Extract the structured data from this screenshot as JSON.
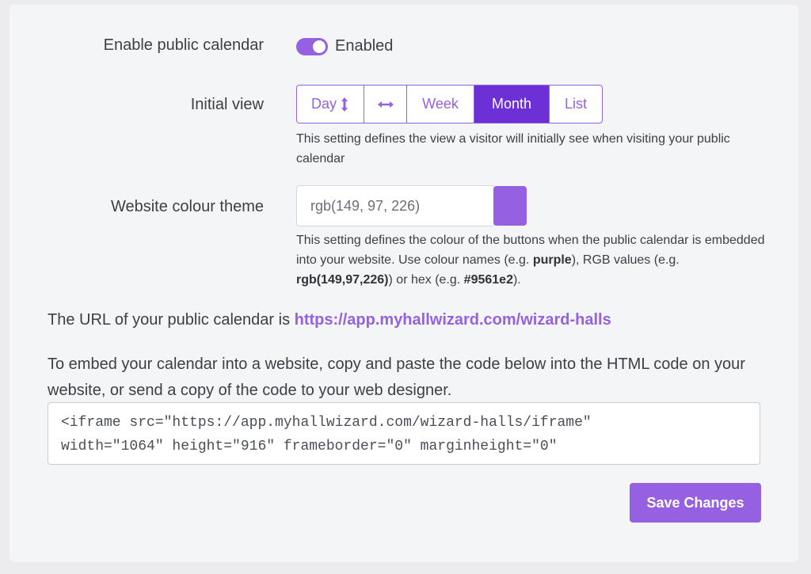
{
  "settings": {
    "public_calendar": {
      "label": "Enable public calendar",
      "status": "Enabled",
      "enabled": true
    },
    "initial_view": {
      "label": "Initial view",
      "options": [
        "Day",
        "",
        "Week",
        "Month",
        "List"
      ],
      "selected": "Month",
      "help": "This setting defines the view a visitor will initially see when visiting your public calendar"
    },
    "colour_theme": {
      "label": "Website colour theme",
      "value": "rgb(149, 97, 226)",
      "swatch_color": "#9561e2",
      "help_before": "This setting defines the colour of the buttons when the public calendar is embedded into your website. Use colour names (e.g. ",
      "help_purple": "purple",
      "help_mid1": "), RGB values (e.g. ",
      "help_rgb": "rgb(149,97,226)",
      "help_mid2": ") or hex (e.g. ",
      "help_hex": "#9561e2",
      "help_end": ")."
    }
  },
  "url_section": {
    "text": "The URL of your public calendar is ",
    "url": "https://app.myhallwizard.com/wizard-halls"
  },
  "embed": {
    "text": "To embed your calendar into a website, copy and paste the code below into the HTML code on your website, or send a copy of the code to your web designer.",
    "code": "<iframe src=\"https://app.myhallwizard.com/wizard-halls/iframe\"\nwidth=\"1064\" height=\"916\" frameborder=\"0\" marginheight=\"0\""
  },
  "actions": {
    "save_label": "Save Changes"
  },
  "colors": {
    "accent": "#9561e2",
    "active": "#6d2fd6"
  },
  "icons": {
    "day": "vertical-arrows-icon",
    "week_alt": "horizontal-arrows-icon"
  }
}
